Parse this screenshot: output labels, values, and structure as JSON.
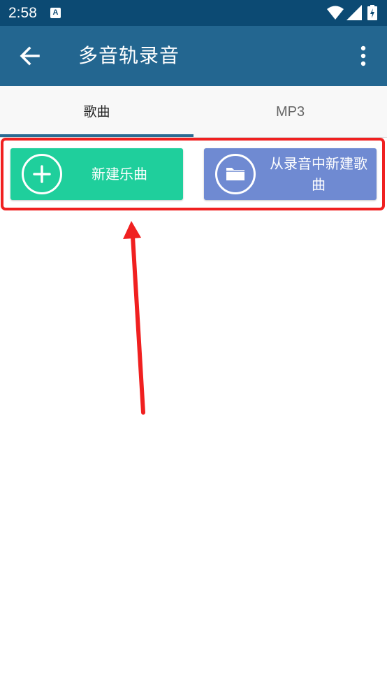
{
  "status_bar": {
    "time": "2:58",
    "notification_icon": "A"
  },
  "app_bar": {
    "title": "多音轨录音"
  },
  "tabs": [
    {
      "label": "歌曲",
      "selected": true
    },
    {
      "label": "MP3",
      "selected": false
    }
  ],
  "actions": {
    "new_song_label": "新建乐曲",
    "from_recording_label": "从录音中新建歌曲"
  },
  "colors": {
    "status_bar": "#0c4a73",
    "app_bar": "#236690",
    "new_song_button": "#1fcf9c",
    "from_recording_button": "#6f8ad2",
    "highlight": "#f02020"
  }
}
